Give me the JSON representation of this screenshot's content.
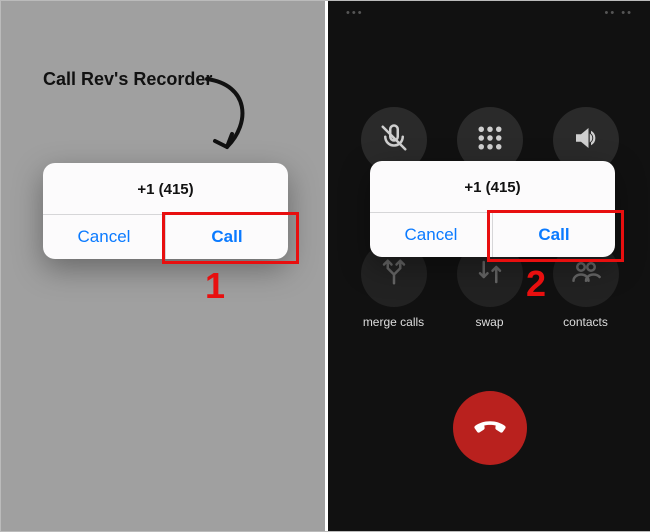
{
  "hint_text": "Call Rev's Recorder",
  "alert": {
    "phone_number": "+1 (415)",
    "cancel_label": "Cancel",
    "call_label": "Call"
  },
  "steps": {
    "one": "1",
    "two": "2"
  },
  "call_controls": {
    "mute": "mute",
    "keypad": "keypad",
    "audio": "audio",
    "merge": "merge calls",
    "swap": "swap",
    "contacts": "contacts"
  },
  "colors": {
    "ios_blue": "#0a7aff",
    "highlight_red": "#e80f0f",
    "endcall_red": "#b9211e"
  }
}
